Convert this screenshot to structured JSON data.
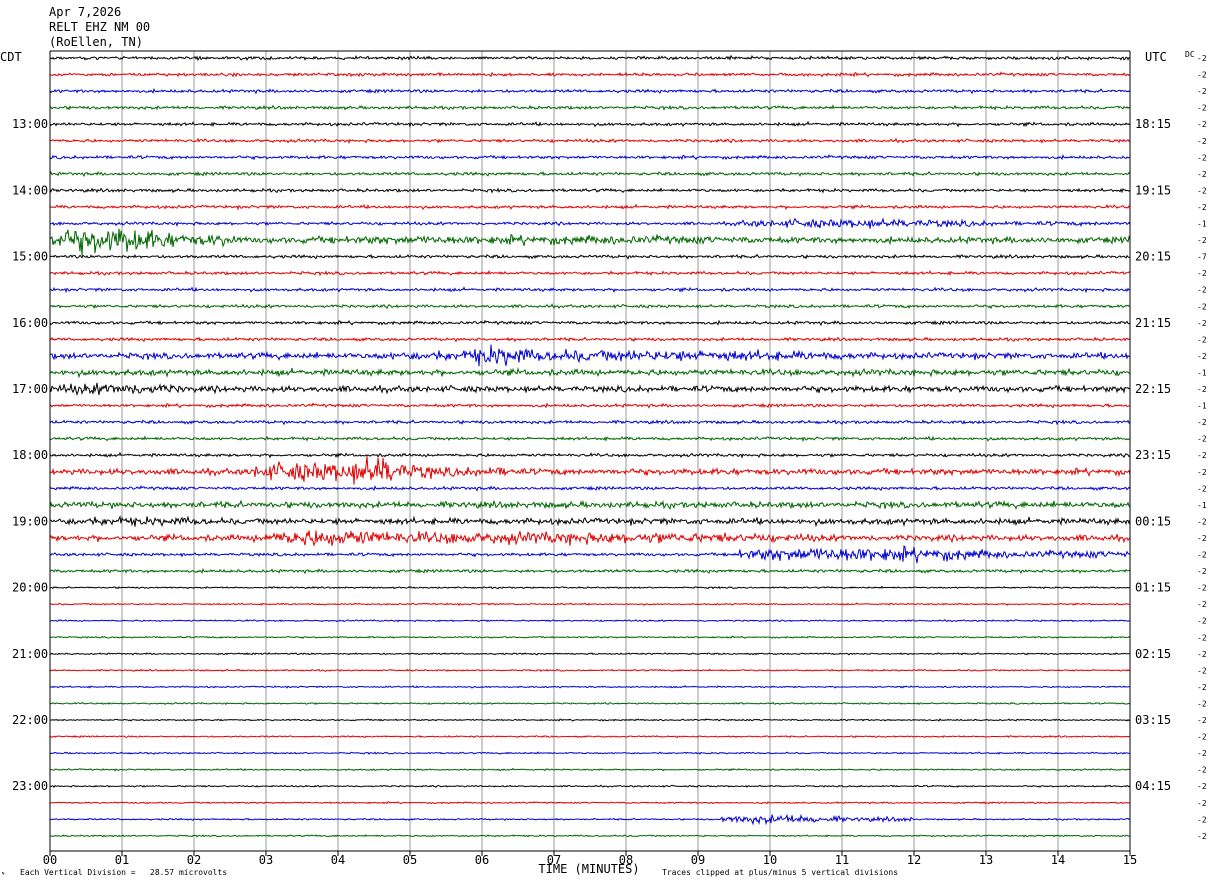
{
  "header": {
    "line1": "Apr 7,2026",
    "line2": "RELT EHZ NM 00",
    "line3": "(RoEllen, TN)"
  },
  "left_timezone": "CDT",
  "right_timezone": "UTC",
  "dc_label": "DC",
  "chart_data": {
    "type": "line",
    "title": "",
    "xlabel": "TIME (MINUTES)",
    "x_ticks": [
      "00",
      "01",
      "02",
      "03",
      "04",
      "05",
      "06",
      "07",
      "08",
      "09",
      "10",
      "11",
      "12",
      "13",
      "14",
      "15"
    ],
    "xlim": [
      0,
      15
    ],
    "row_count": 48,
    "row_minutes": 15,
    "series_colors": [
      "#000000",
      "#e00000",
      "#0000d0",
      "#006600"
    ],
    "left_hour_labels": [
      {
        "row": 4,
        "label": "13:00"
      },
      {
        "row": 8,
        "label": "14:00"
      },
      {
        "row": 12,
        "label": "15:00"
      },
      {
        "row": 16,
        "label": "16:00"
      },
      {
        "row": 20,
        "label": "17:00"
      },
      {
        "row": 24,
        "label": "18:00"
      },
      {
        "row": 28,
        "label": "19:00"
      },
      {
        "row": 32,
        "label": "20:00"
      },
      {
        "row": 36,
        "label": "21:00"
      },
      {
        "row": 40,
        "label": "22:00"
      },
      {
        "row": 44,
        "label": "23:00"
      }
    ],
    "right_hour_labels": [
      {
        "row": 4,
        "label": "18:15"
      },
      {
        "row": 8,
        "label": "19:15"
      },
      {
        "row": 12,
        "label": "20:15"
      },
      {
        "row": 16,
        "label": "21:15"
      },
      {
        "row": 20,
        "label": "22:15"
      },
      {
        "row": 24,
        "label": "23:15"
      },
      {
        "row": 28,
        "label": "00:15"
      },
      {
        "row": 32,
        "label": "01:15"
      },
      {
        "row": 36,
        "label": "02:15"
      },
      {
        "row": 40,
        "label": "03:15"
      },
      {
        "row": 44,
        "label": "04:15"
      }
    ],
    "dc_offsets": [
      "-2",
      "-2",
      "-2",
      "-2",
      "-2",
      "-2",
      "-2",
      "-2",
      "-2",
      "-2",
      "-1",
      "-2",
      "-7",
      "-2",
      "-2",
      "-2",
      "-2",
      "-2",
      "-2",
      "-1",
      "-2",
      "-1",
      "-2",
      "-2",
      "-2",
      "-2",
      "-2",
      "-1",
      "-2",
      "-2",
      "-2",
      "-2",
      "-2",
      "-2",
      "-2",
      "-2",
      "-2",
      "-2",
      "-2",
      "-2",
      "-2",
      "-2",
      "-2",
      "-2",
      "-2",
      "-2",
      "-2",
      "-2"
    ],
    "amplitude_levels": [
      1,
      1,
      1,
      1,
      1,
      1,
      1,
      1,
      1,
      1,
      1,
      2,
      1,
      1,
      1,
      1,
      1,
      1,
      2,
      2,
      2,
      1,
      1,
      1,
      1,
      2,
      1,
      2,
      2,
      2,
      1,
      1,
      0.5,
      0.5,
      0.5,
      0.5,
      0.5,
      0.5,
      0.5,
      0.5,
      0.5,
      0.5,
      0.5,
      0.5,
      0.5,
      0.5,
      0.5,
      0.5
    ],
    "events": [
      {
        "row": 10,
        "start_min": 9.5,
        "end_min": 15,
        "level": 3
      },
      {
        "row": 11,
        "start_min": 0,
        "end_min": 2.6,
        "level": 9
      },
      {
        "row": 11,
        "start_min": 2.6,
        "end_min": 15,
        "level": 3
      },
      {
        "row": 18,
        "start_min": 4.6,
        "end_min": 15,
        "level": 4
      },
      {
        "row": 18,
        "start_min": 5.8,
        "end_min": 7.2,
        "level": 7
      },
      {
        "row": 20,
        "start_min": 0,
        "end_min": 3,
        "level": 4
      },
      {
        "row": 25,
        "start_min": 2.8,
        "end_min": 6.5,
        "level": 7
      },
      {
        "row": 25,
        "start_min": 4.2,
        "end_min": 5.3,
        "level": 11
      },
      {
        "row": 30,
        "start_min": 9.5,
        "end_min": 15,
        "level": 5
      },
      {
        "row": 28,
        "start_min": 0,
        "end_min": 4,
        "level": 3
      },
      {
        "row": 29,
        "start_min": 2.8,
        "end_min": 15,
        "level": 4
      },
      {
        "row": 29,
        "start_min": 3,
        "end_min": 6,
        "level": 6
      },
      {
        "row": 46,
        "start_min": 9.3,
        "end_min": 12,
        "level": 3
      }
    ]
  },
  "footer": {
    "scale_text": "Each Vertical Division =   28.57 microvolts",
    "clip_text": "Traces clipped at plus/minus 5 vertical divisions"
  }
}
